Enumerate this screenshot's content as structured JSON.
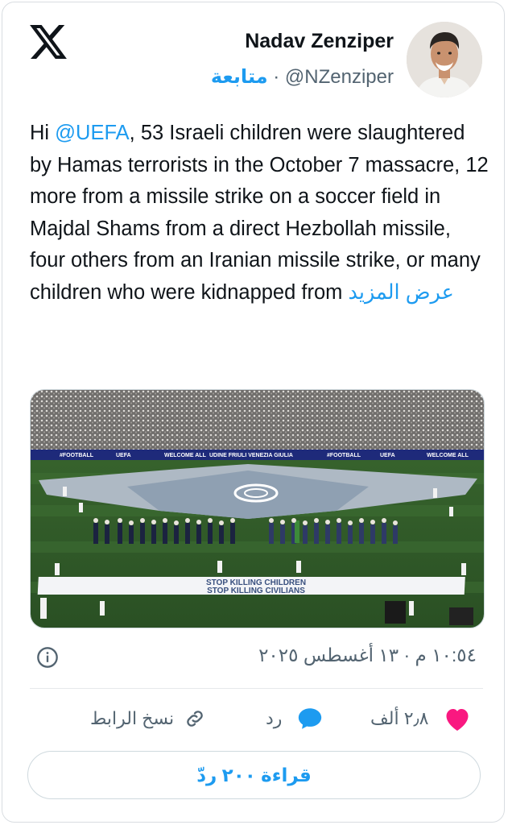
{
  "tweet": {
    "author_name": "Nadav Zenziper",
    "handle": "@NZenziper",
    "separator": " · ",
    "follow_label": "متابعة",
    "text_prefix": "Hi ",
    "mention": "@UEFA",
    "text_body": ", 53 Israeli children were slaughtered by Hamas terrorists in the October 7 massacre, 12 more from a missile strike on a soccer field in Majdal Shams from a direct Hezbollah missile, four others from an Iranian missile strike, or many children who were kidnapped from ",
    "show_more": "عرض المزيد",
    "timestamp": "١٠:٥٤ م · ١٣ أغسطس ٢٠٢٥",
    "likes_count": "٢٫٨ ألف",
    "reply_label": "رد",
    "copy_link_label": "نسخ الرابط",
    "read_replies_label": "قراءة ٢٠٠ ردّ"
  },
  "media": {
    "board_texts": [
      "#FOOTBALL",
      "UEFA",
      "WELCOME ALL",
      "UDINE FRIULI VENEZIA GIULIA",
      "#FOOTBALL",
      "UEFA",
      "WELCOME ALL"
    ],
    "banner_line_1": "STOP KILLING CHILDREN",
    "banner_line_2": "STOP KILLING CIVILIANS"
  },
  "icons": {
    "logo": "x-logo-icon",
    "info": "info-icon",
    "like": "heart-icon",
    "reply": "speech-bubble-icon",
    "copy_link": "link-icon"
  },
  "colors": {
    "accent": "#1d9bf0",
    "like": "#f91880",
    "text": "#0f1419",
    "muted": "#536471"
  }
}
